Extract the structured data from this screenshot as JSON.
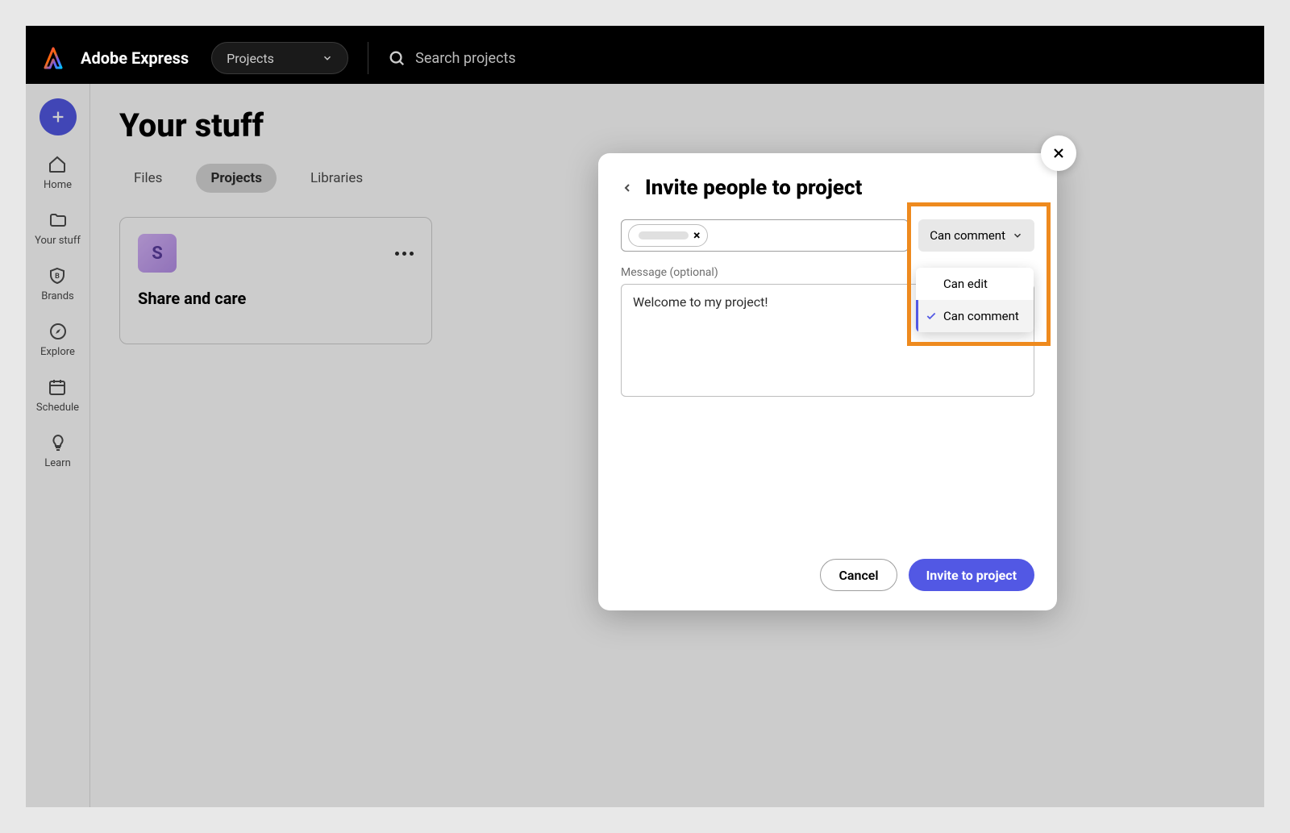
{
  "header": {
    "brand": "Adobe Express",
    "dropdown": "Projects",
    "search_placeholder": "Search projects"
  },
  "sidebar": {
    "items": [
      {
        "label": "Home"
      },
      {
        "label": "Your stuff"
      },
      {
        "label": "Brands"
      },
      {
        "label": "Explore"
      },
      {
        "label": "Schedule"
      },
      {
        "label": "Learn"
      }
    ]
  },
  "main": {
    "title": "Your stuff",
    "tabs": [
      {
        "label": "Files"
      },
      {
        "label": "Projects"
      },
      {
        "label": "Libraries"
      }
    ],
    "card": {
      "initial": "S",
      "title": "Share and care"
    }
  },
  "modal": {
    "title": "Invite people to project",
    "permission_button": "Can comment",
    "message_label": "Message (optional)",
    "message_value": "Welcome to my project!",
    "cancel": "Cancel",
    "invite": "Invite to project",
    "options": [
      {
        "label": "Can edit"
      },
      {
        "label": "Can comment"
      }
    ]
  }
}
